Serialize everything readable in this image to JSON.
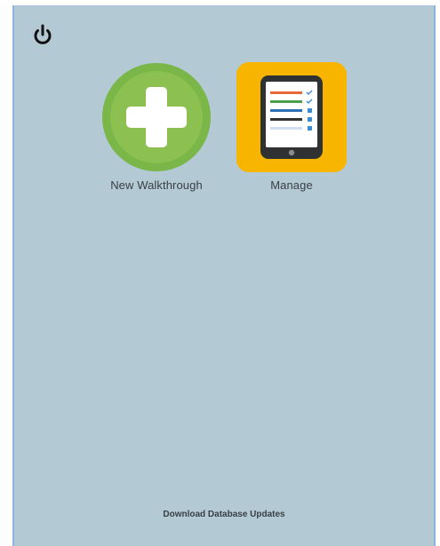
{
  "header": {
    "power_icon": "power-icon"
  },
  "tiles": [
    {
      "label": "New Walkthrough",
      "icon": "plus-circle-icon",
      "color": "#7ab648"
    },
    {
      "label": "Manage",
      "icon": "tablet-checklist-icon",
      "color": "#f7b500"
    }
  ],
  "footer": {
    "download_label": "Download Database Updates"
  },
  "colors": {
    "background": "#b3c9d3",
    "new_accent": "#7ab648",
    "manage_accent": "#f7b500"
  }
}
